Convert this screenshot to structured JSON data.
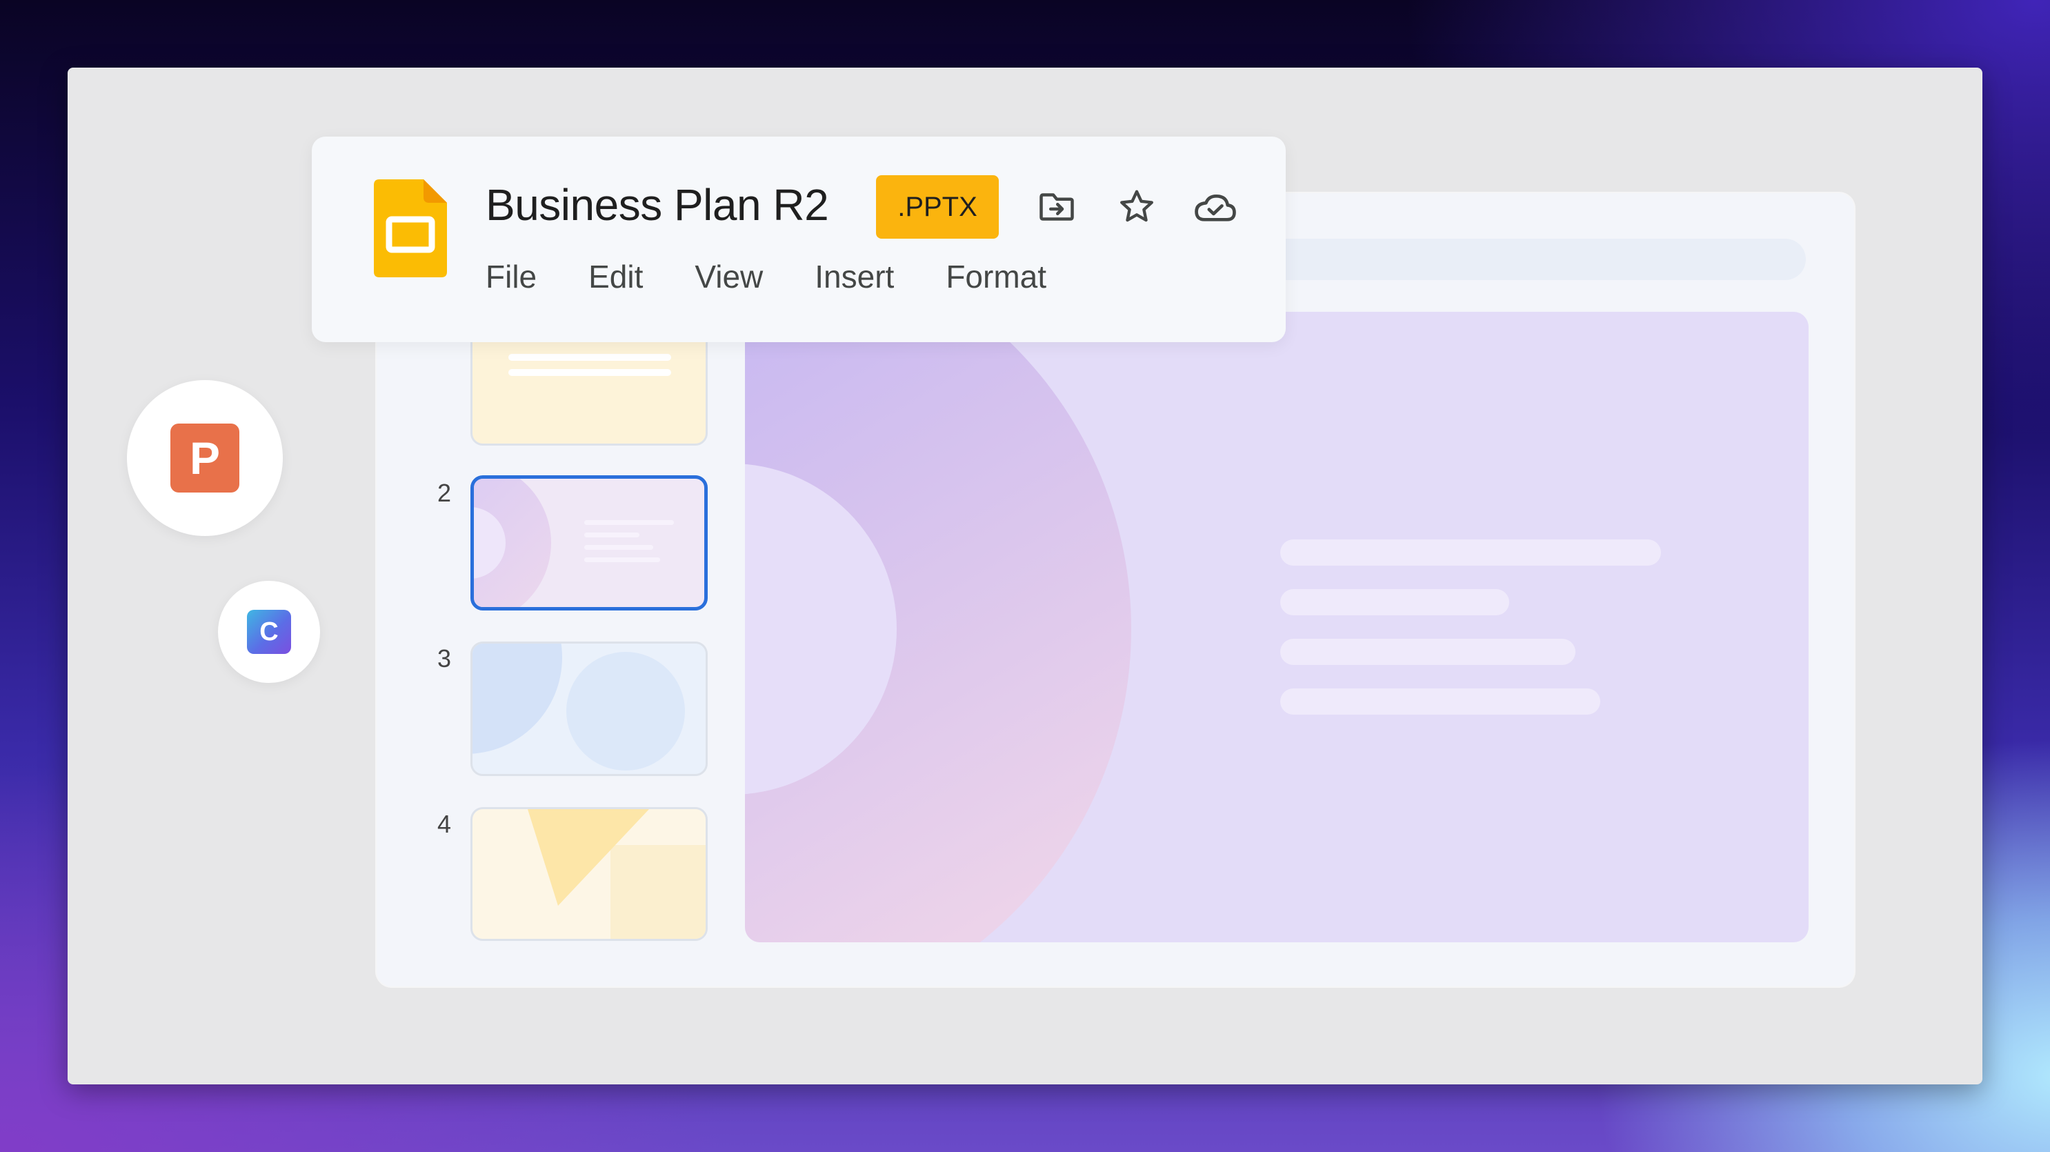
{
  "document": {
    "title": "Business Plan R2",
    "format_badge": ".PPTX"
  },
  "toolbar": {
    "icons": [
      "move-to-folder-icon",
      "star-icon",
      "cloud-saved-icon"
    ]
  },
  "menu": {
    "items": [
      {
        "label": "File"
      },
      {
        "label": "Edit"
      },
      {
        "label": "View"
      },
      {
        "label": "Insert"
      },
      {
        "label": "Format"
      }
    ]
  },
  "apps": {
    "powerpoint_letter": "P",
    "canva_letter": "C"
  },
  "slides": [
    {
      "number": "2",
      "selected": true
    },
    {
      "number": "3",
      "selected": false
    },
    {
      "number": "4",
      "selected": false
    }
  ],
  "colors": {
    "slides_icon": "#fbbc04",
    "pptx_badge": "#fbb40e",
    "selected_slide_border": "#2a6fdb",
    "powerpoint": "#e8714a"
  }
}
